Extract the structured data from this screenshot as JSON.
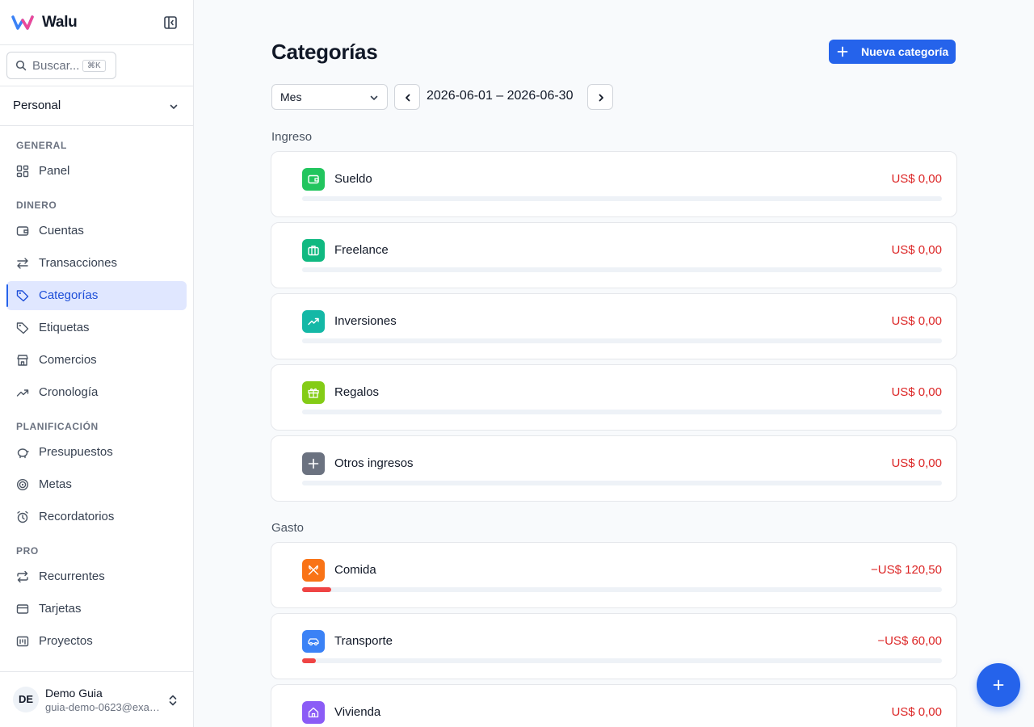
{
  "app": {
    "name": "Walu"
  },
  "search": {
    "placeholder": "Buscar...",
    "shortcut": "⌘K"
  },
  "workspace": {
    "label": "Personal"
  },
  "sidebar": {
    "sections": {
      "general": "GENERAL",
      "dinero": "DINERO",
      "planificacion": "PLANIFICACIÓN",
      "pro": "PRO"
    },
    "items": [
      {
        "label": "Panel",
        "icon": "dashboard-icon"
      },
      {
        "label": "Cuentas",
        "icon": "wallet-icon"
      },
      {
        "label": "Transacciones",
        "icon": "arrows-icon"
      },
      {
        "label": "Categorías",
        "icon": "tag-icon",
        "active": true
      },
      {
        "label": "Etiquetas",
        "icon": "label-icon"
      },
      {
        "label": "Comercios",
        "icon": "store-icon"
      },
      {
        "label": "Cronología",
        "icon": "trend-icon"
      },
      {
        "label": "Presupuestos",
        "icon": "piggy-bank-icon"
      },
      {
        "label": "Metas",
        "icon": "target-icon"
      },
      {
        "label": "Recordatorios",
        "icon": "alarm-icon"
      },
      {
        "label": "Recurrentes",
        "icon": "repeat-icon"
      },
      {
        "label": "Tarjetas",
        "icon": "credit-card-icon"
      },
      {
        "label": "Proyectos",
        "icon": "folder-icon"
      }
    ]
  },
  "user": {
    "initials": "DE",
    "name": "Demo Guia",
    "email": "guia-demo-0623@example.com"
  },
  "page": {
    "title": "Categorías",
    "new_button": "Nueva categoría",
    "period": "Mes",
    "range": "2026-06-01 – 2026-06-30"
  },
  "groups": {
    "income": {
      "label": "Ingreso",
      "items": [
        {
          "name": "Sueldo",
          "amount": "US$ 0,00",
          "color": "#22c55e",
          "icon": "wallet-icon",
          "progress": 0
        },
        {
          "name": "Freelance",
          "amount": "US$ 0,00",
          "color": "#10b981",
          "icon": "briefcase-icon",
          "progress": 0
        },
        {
          "name": "Inversiones",
          "amount": "US$ 0,00",
          "color": "#14b8a6",
          "icon": "trend-up-icon",
          "progress": 0
        },
        {
          "name": "Regalos",
          "amount": "US$ 0,00",
          "color": "#84cc16",
          "icon": "gift-icon",
          "progress": 0
        },
        {
          "name": "Otros ingresos",
          "amount": "US$ 0,00",
          "color": "#6b7280",
          "icon": "plus-icon",
          "progress": 0
        }
      ]
    },
    "expense": {
      "label": "Gasto",
      "items": [
        {
          "name": "Comida",
          "amount": "−US$ 120,50",
          "color": "#f97316",
          "icon": "utensils-icon",
          "progress": 0.045
        },
        {
          "name": "Transporte",
          "amount": "−US$ 60,00",
          "color": "#3b82f6",
          "icon": "car-icon",
          "progress": 0.022
        },
        {
          "name": "Vivienda",
          "amount": "US$ 0,00",
          "color": "#8b5cf6",
          "icon": "home-icon",
          "progress": 0
        }
      ]
    }
  },
  "colors": {
    "accent": "#2563eb",
    "negative": "#dc2626"
  }
}
